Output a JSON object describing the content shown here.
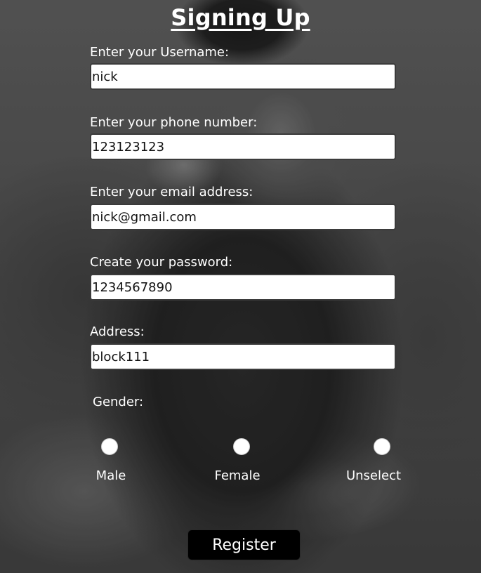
{
  "form": {
    "title": "Signing Up",
    "fields": [
      {
        "label": "Enter your Username:",
        "value": "nick"
      },
      {
        "label": "Enter your phone number:",
        "value": "123123123"
      },
      {
        "label": "Enter your email address:",
        "value": "nick@gmail.com"
      },
      {
        "label": "Create your password:",
        "value": "1234567890"
      },
      {
        "label": "Address:",
        "value": "block111"
      }
    ],
    "gender": {
      "label": "Gender:",
      "options": [
        "Male",
        "Female",
        "Unselect"
      ]
    },
    "register_label": "Register"
  },
  "colors": {
    "text": "#ffffff",
    "input_background": "#ffffff",
    "button_background": "#000000"
  }
}
